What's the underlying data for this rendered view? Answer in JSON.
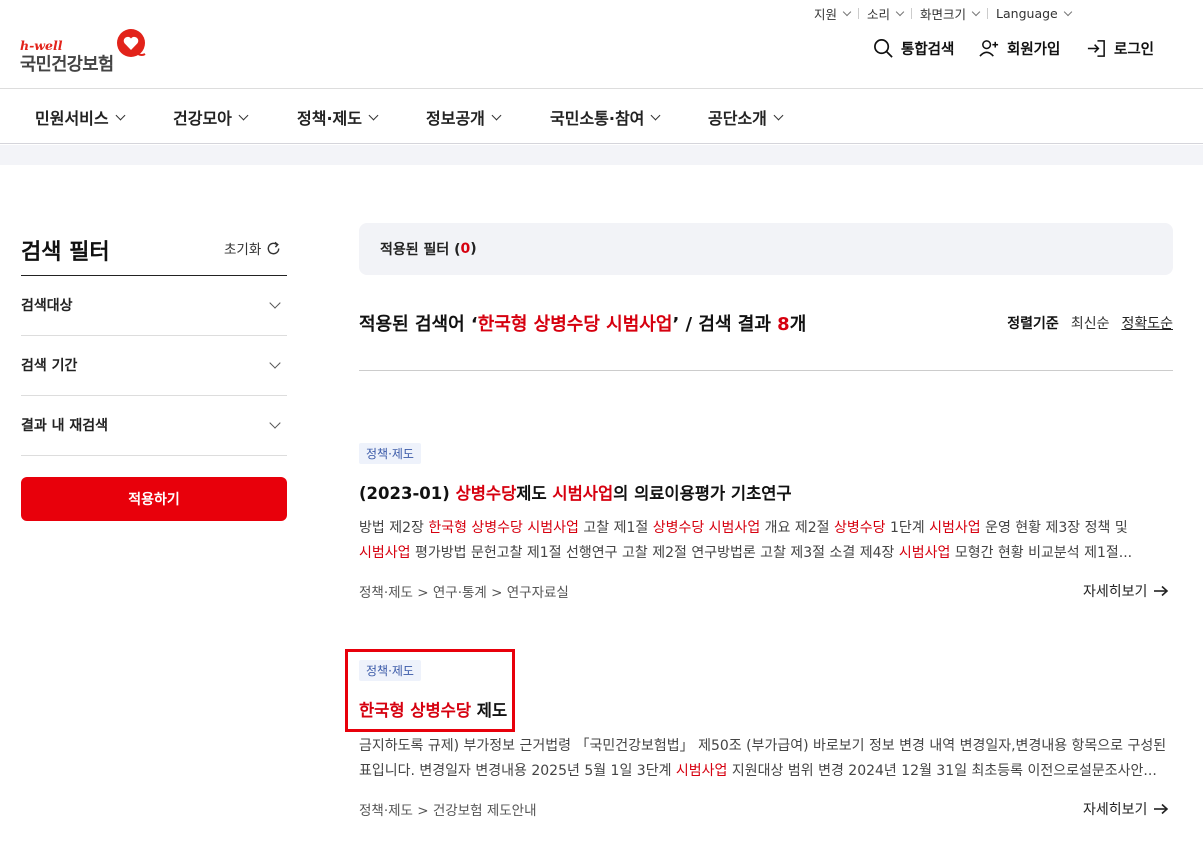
{
  "util_menu": [
    {
      "label": "지원"
    },
    {
      "label": "소리"
    },
    {
      "label": "화면크기"
    },
    {
      "label": "Language"
    }
  ],
  "logo": {
    "tagline": "h-well",
    "name": "국민건강보험"
  },
  "header_actions": {
    "search": "통합검색",
    "signup": "회원가입",
    "login": "로그인"
  },
  "gnb": [
    {
      "label": "민원서비스"
    },
    {
      "label": "건강모아"
    },
    {
      "label": "정책·제도"
    },
    {
      "label": "정보공개"
    },
    {
      "label": "국민소통·참여"
    },
    {
      "label": "공단소개"
    }
  ],
  "sidebar": {
    "title": "검색 필터",
    "reset": "초기화",
    "accordions": [
      {
        "label": "검색대상"
      },
      {
        "label": "검색 기간"
      },
      {
        "label": "결과 내 재검색"
      }
    ],
    "apply": "적용하기"
  },
  "applied_filters": {
    "label": "적용된 필터 (",
    "count": "0",
    "suffix": ")"
  },
  "result_header": {
    "prefix": "적용된 검색어 ‘",
    "keyword": "한국형 상병수당 시범사업",
    "middle": "’ / 검색 결과 ",
    "count": "8",
    "suffix": "개"
  },
  "sort": {
    "label": "정렬기준",
    "options": [
      "최신순",
      "정확도순"
    ],
    "active": "정확도순"
  },
  "results": [
    {
      "tag": "정책·제도",
      "title_parts": [
        {
          "text": "(2023-01) ",
          "hl": false
        },
        {
          "text": "상병수당",
          "hl": true
        },
        {
          "text": "제도 ",
          "hl": false
        },
        {
          "text": "시범사업",
          "hl": true
        },
        {
          "text": "의 의료이용평가 기초연구",
          "hl": false
        }
      ],
      "desc_lines": [
        [
          {
            "text": "방법  제2장 ",
            "hl": false
          },
          {
            "text": "한국형 상병수당 시범사업",
            "hl": true
          },
          {
            "text": " 고찰  제1절 ",
            "hl": false
          },
          {
            "text": "상병수당 시범사업",
            "hl": true
          },
          {
            "text": " 개요  제2절 ",
            "hl": false
          },
          {
            "text": "상병수당",
            "hl": true
          },
          {
            "text": " 1단계 ",
            "hl": false
          },
          {
            "text": "시범사업",
            "hl": true
          },
          {
            "text": " 운영 현황  제3장 정책 및",
            "hl": false
          }
        ],
        [
          {
            "text": "시범사업",
            "hl": true
          },
          {
            "text": " 평가방법 문헌고찰  제1절 선행연구 고찰  제2절 연구방법론 고찰  제3절 소결  제4장 ",
            "hl": false
          },
          {
            "text": "시범사업",
            "hl": true
          },
          {
            "text": " 모형간 현황 비교분석  제1절...",
            "hl": false
          }
        ]
      ],
      "path": "정책·제도 > 연구·통계 > 연구자료실",
      "more": "자세히보기"
    },
    {
      "tag": "정책·제도",
      "title_parts": [
        {
          "text": "한국형 상병수당",
          "hl": true
        },
        {
          "text": " 제도",
          "hl": false
        }
      ],
      "desc_lines": [
        [
          {
            "text": "금지하도록 규제) 부가정보 근거법령 「국민건강보험법」 제50조 (부가급여) 바로보기 정보 변경 내역 변경일자,변경내용 항목으로 구성된",
            "hl": false
          }
        ],
        [
          {
            "text": "표입니다. 변경일자 변경내용 2025년 5월 1일 3단계 ",
            "hl": false
          },
          {
            "text": "시범사업",
            "hl": true
          },
          {
            "text": " 지원대상 범위 변경 2024년 12월 31일 최초등록 이전으로설문조사안...",
            "hl": false
          }
        ]
      ],
      "path": "정책·제도 > 건강보험 제도안내",
      "more": "자세히보기"
    }
  ],
  "colors": {
    "brand_red": "#e8000b",
    "highlight_red": "#d6000f",
    "tag_bg": "#eef2fb",
    "tag_text": "#3b5aa8"
  }
}
